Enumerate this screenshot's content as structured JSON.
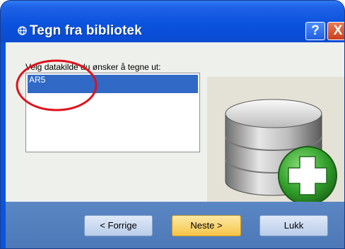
{
  "window": {
    "title": "Tegn fra bibliotek",
    "help_label": "?",
    "close_label": "X"
  },
  "content": {
    "prompt": "Velg datakilde du ønsker å tegne ut:",
    "datasources": [
      {
        "label": "AR5",
        "selected": true
      }
    ]
  },
  "footer": {
    "prev_label": "< Forrige",
    "next_label": "Neste >",
    "close_label": "Lukk"
  },
  "icons": {
    "title": "globe-icon",
    "illustration": "database-add-icon"
  },
  "colors": {
    "titlebar": "#0b52dd",
    "selection": "#3169c6",
    "footer": "#5580bd",
    "annotation": "#e0101a",
    "add_badge": "#2f9a2c"
  }
}
